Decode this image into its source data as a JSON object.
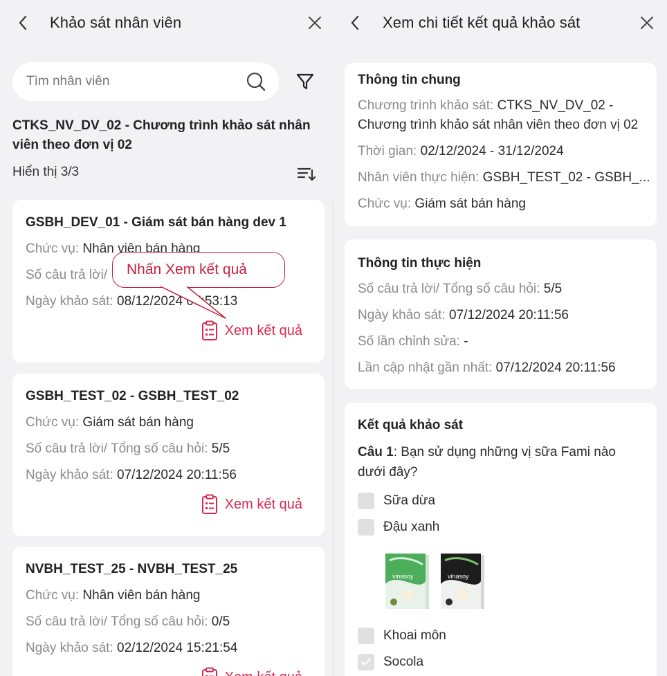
{
  "left": {
    "title": "Khảo sát nhân viên",
    "search_placeholder": "Tìm nhân viên",
    "program_title": "CTKS_NV_DV_02 - Chương trình khảo sát nhân viên theo đơn vị 02",
    "count_label": "Hiển thị 3/3",
    "callout": "Nhấn Xem kết quả",
    "cards": [
      {
        "name": "GSBH_DEV_01 - Giám sát bán hàng dev 1",
        "role_label": "Chức vụ:",
        "role_value": "Nhân viên bán hàng",
        "answers_label": "Số câu trả lời/",
        "answers_value": "",
        "date_label": "Ngày khảo sát:",
        "date_value": "08/12/2024 07:53:13",
        "result_label": "Xem kết quả"
      },
      {
        "name": "GSBH_TEST_02 - GSBH_TEST_02",
        "role_label": "Chức vụ:",
        "role_value": "Giám sát bán hàng",
        "answers_label": "Số câu trả lời/ Tổng số câu hỏi:",
        "answers_value": "5/5",
        "date_label": "Ngày khảo sát:",
        "date_value": "07/12/2024 20:11:56",
        "result_label": "Xem kết quả"
      },
      {
        "name": "NVBH_TEST_25 - NVBH_TEST_25",
        "role_label": "Chức vụ:",
        "role_value": "Nhân viên bán hàng",
        "answers_label": "Số câu trả lời/ Tổng số câu hỏi:",
        "answers_value": "0/5",
        "date_label": "Ngày khảo sát:",
        "date_value": "02/12/2024 15:21:54",
        "result_label": "Xem kết quả"
      }
    ]
  },
  "right": {
    "title": "Xem chi tiết kết quả khảo sát",
    "general": {
      "heading": "Thông tin chung",
      "program_label": "Chương trình khảo sát:",
      "program_value": "CTKS_NV_DV_02 - Chương trình khảo sát nhân viên theo đơn vị 02",
      "time_label": "Thời gian:",
      "time_value": "02/12/2024 - 31/12/2024",
      "staff_label": "Nhân viên thực hiện:",
      "staff_value": "GSBH_TEST_02 - GSBH_...",
      "role_label": "Chức vụ:",
      "role_value": "Giám sát bán hàng"
    },
    "execution": {
      "heading": "Thông tin thực hiện",
      "answers_label": "Số câu trả lời/ Tổng số câu hỏi:",
      "answers_value": "5/5",
      "date_label": "Ngày khảo sát:",
      "date_value": "07/12/2024 20:11:56",
      "edits_label": "Số lần chỉnh sửa:",
      "edits_value": "-",
      "updated_label": "Lần cập nhật gần nhất:",
      "updated_value": "07/12/2024 20:11:56"
    },
    "results": {
      "heading": "Kết quả khảo sát",
      "q1_label": "Câu 1",
      "q1_text": ": Bạn sử dụng những vị sữa Fami nào dưới đây?",
      "options": [
        {
          "label": "Sữa dừa",
          "checked": false
        },
        {
          "label": "Đậu xanh",
          "checked": false
        },
        {
          "label": "Khoai môn",
          "checked": false
        },
        {
          "label": "Socola",
          "checked": true
        }
      ],
      "product_brand": "vinasoy"
    }
  },
  "colors": {
    "accent": "#d9294e",
    "background": "#f2f2f4",
    "card": "#ffffff",
    "muted_text": "#8a8a8a"
  }
}
